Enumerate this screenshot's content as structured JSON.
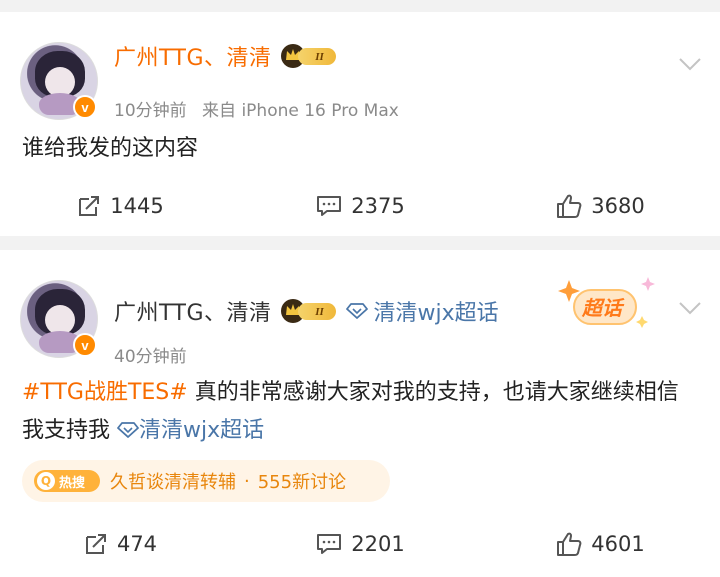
{
  "posts": [
    {
      "username": "广州TTG、清清",
      "vip_level": "II",
      "time": "10分钟前",
      "source": "来自 iPhone 16 Pro Max",
      "text": "谁给我发的这内容",
      "repost_count": "1445",
      "comment_count": "2375",
      "like_count": "3680"
    },
    {
      "username": "广州TTG、清清",
      "vip_level": "II",
      "topic_link": "清清wjx超话",
      "sticker_text": "超话",
      "time": "40分钟前",
      "hashtag": "#TTG战胜TES#",
      "text": " 真的非常感谢大家对我的支持，也请大家继续相信我支持我 ",
      "inline_topic": "清清wjx超话",
      "hot_badge": "热搜",
      "hot_title": "久哲谈清清转辅",
      "hot_sep": "·",
      "hot_discussion": "555新讨论",
      "repost_count": "474",
      "comment_count": "2201",
      "like_count": "4601"
    }
  ],
  "colors": {
    "accent_orange": "#f86c00",
    "link_blue": "#4a76a8",
    "meta_gray": "#8a8a8a"
  },
  "icons": [
    "repost-icon",
    "comment-icon",
    "like-icon",
    "chevron-down-icon",
    "diamond-icon",
    "verified-v-icon"
  ]
}
